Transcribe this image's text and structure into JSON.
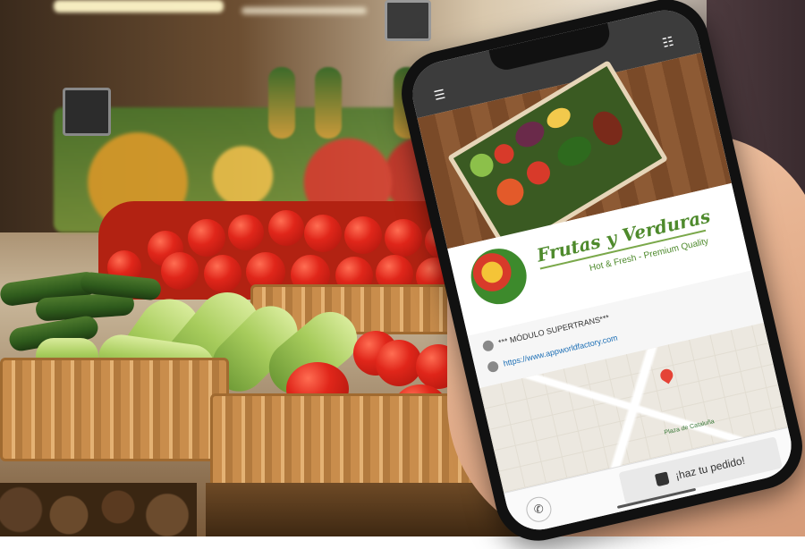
{
  "app": {
    "brand_name": "Frutas y Verduras",
    "tagline": "Hot & Fresh - Premium Quality",
    "module_label": "*** MÓDULO SUPERTRANS***",
    "website": "https://www.appworldfactory.com",
    "order_button": "¡haz tu pedido!",
    "map_labels": [
      "Plaza de Cataluña"
    ]
  },
  "icons": {
    "menu": "hamburger-icon",
    "list": "list-icon",
    "info": "info-icon",
    "link": "link-icon",
    "map_pin": "map-pin-icon",
    "phone": "phone-icon",
    "bag": "shopping-bag-icon"
  },
  "colors": {
    "brand_green": "#4e8a2c",
    "topbar": "#3c3c3c",
    "link": "#1d6fb5",
    "pin": "#e54336"
  }
}
